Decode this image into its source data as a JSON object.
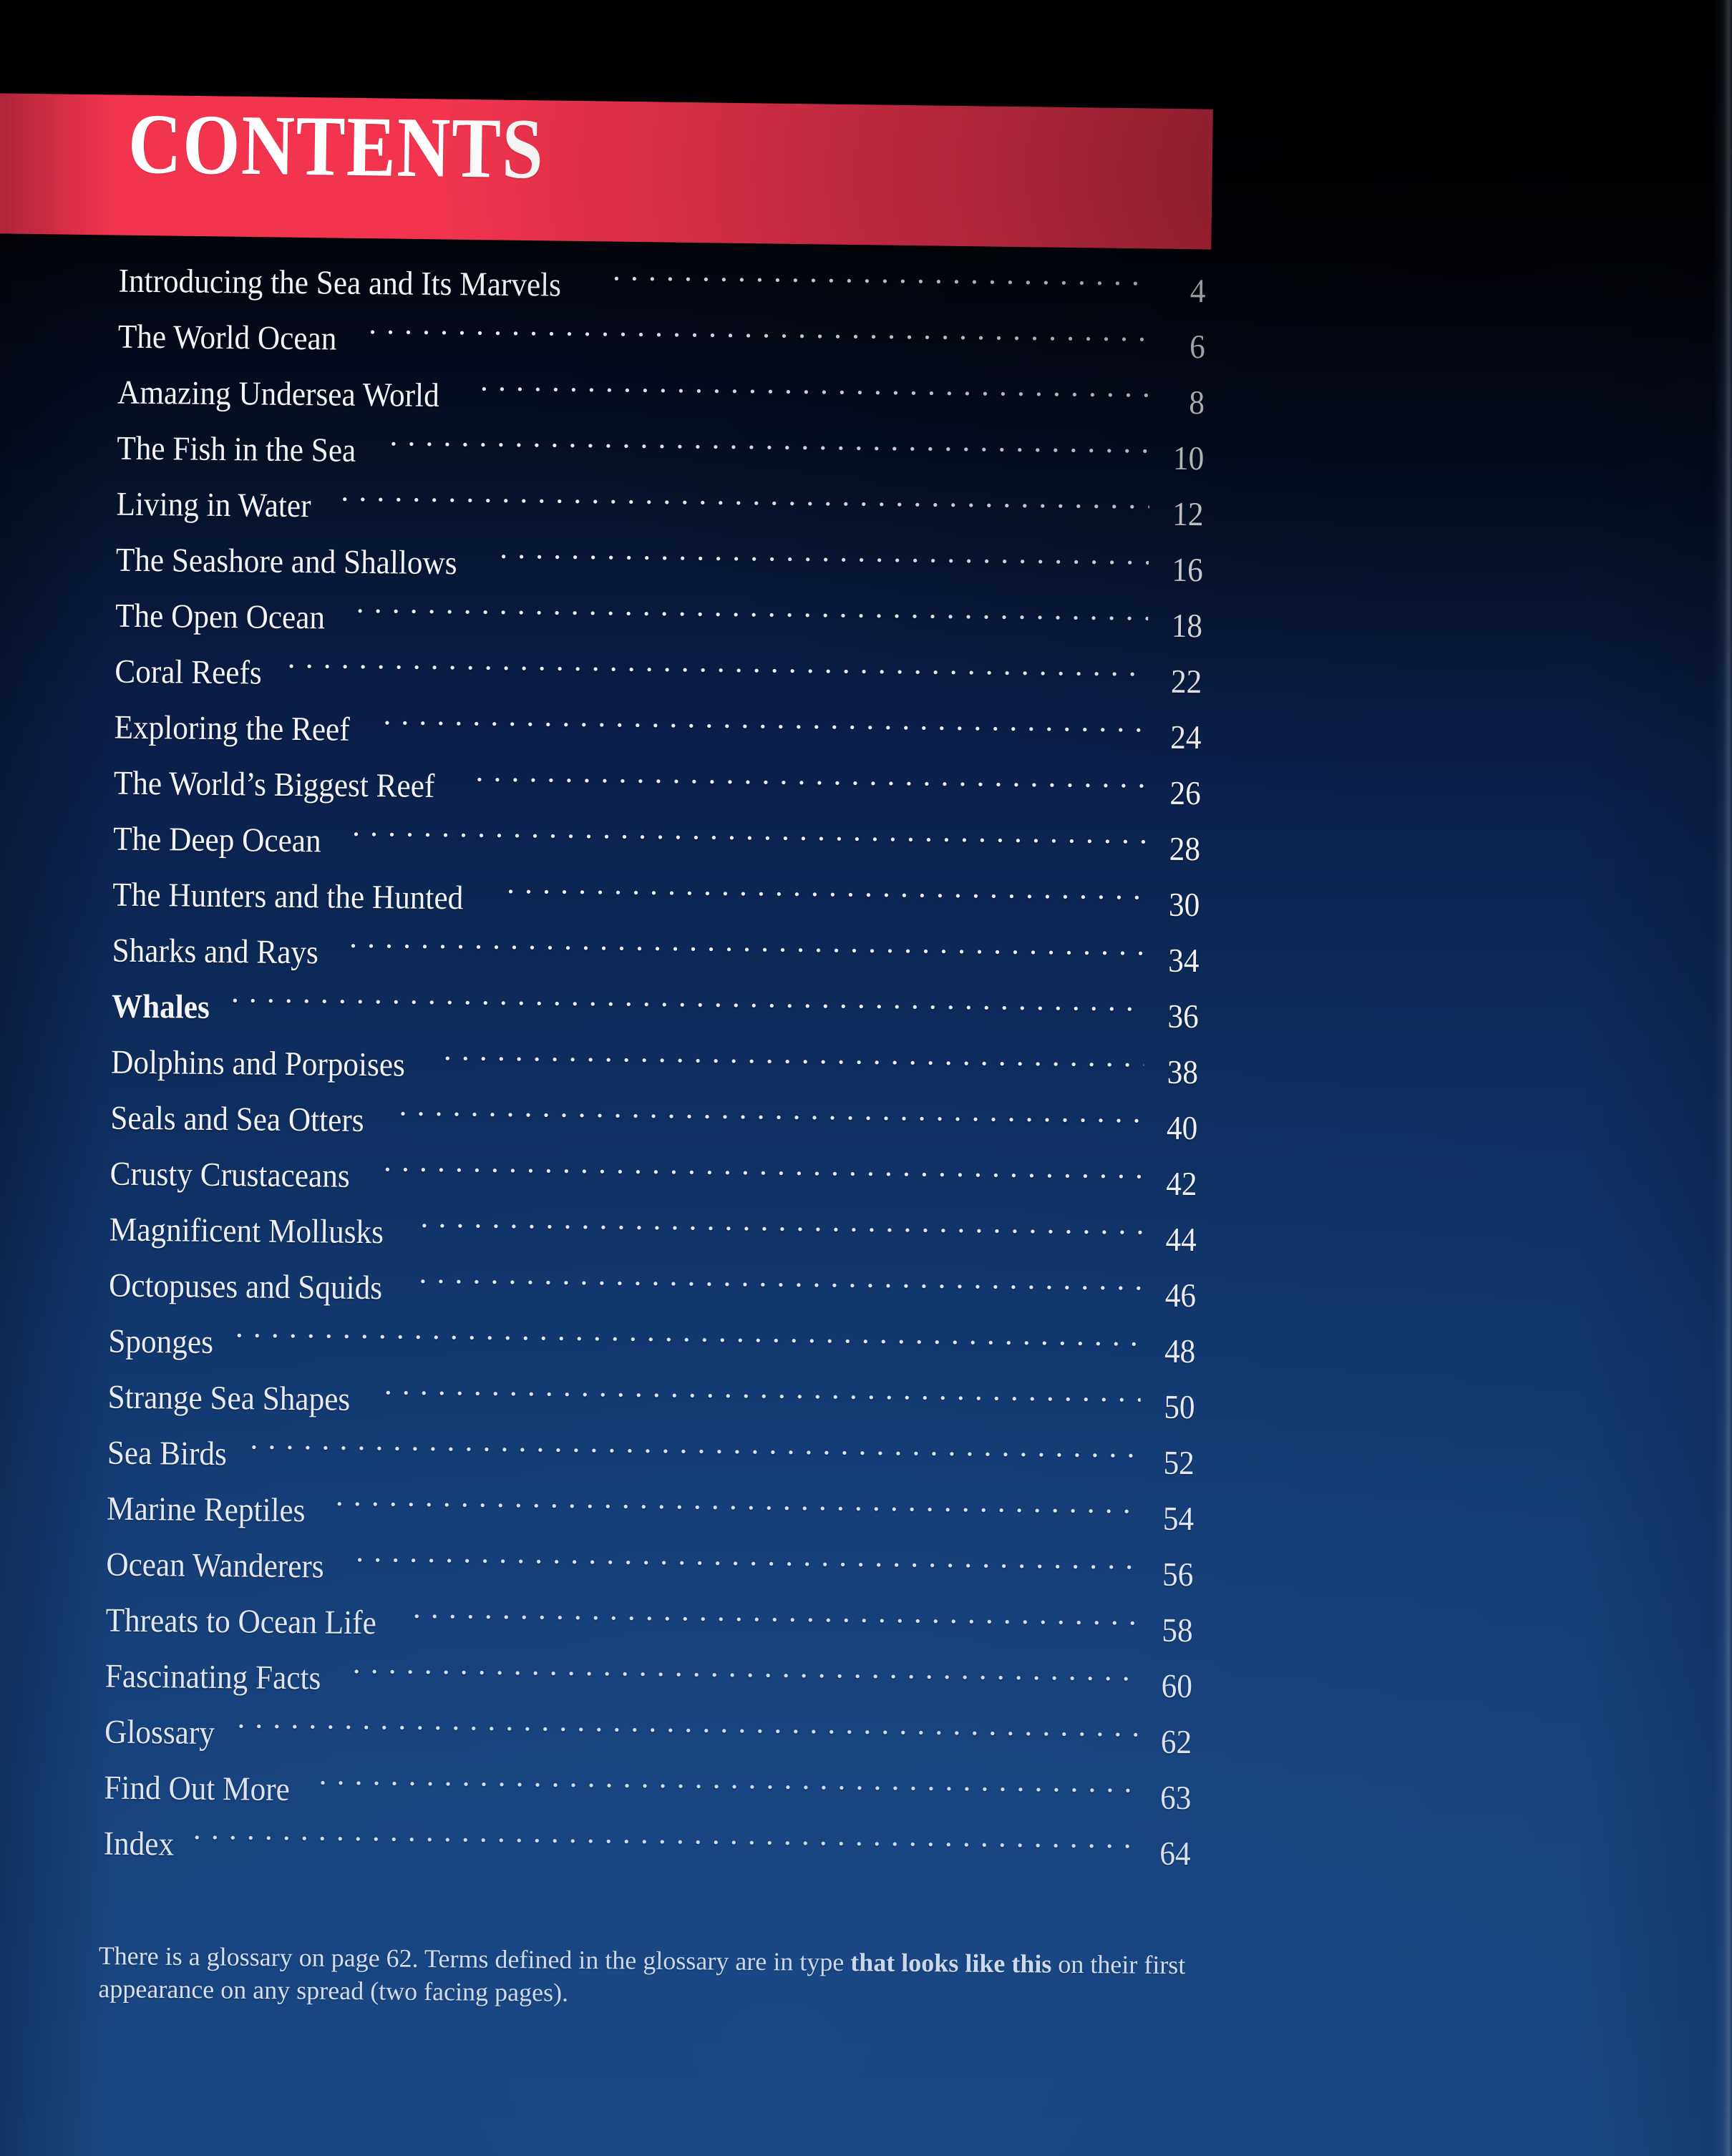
{
  "header": {
    "title": "CONTENTS",
    "banner_color": "#f3344f",
    "title_color": "#ffffff"
  },
  "page": {
    "background_top_color": "#000000",
    "background_bottom_color": "#184480",
    "text_color": "#f2f4f7"
  },
  "contents": {
    "leader_char": ".",
    "entries": [
      {
        "title": "Introducing the Sea and Its Marvels",
        "page": "4"
      },
      {
        "title": "The World Ocean",
        "page": "6"
      },
      {
        "title": "Amazing Undersea World",
        "page": "8"
      },
      {
        "title": "The Fish in the Sea",
        "page": "10"
      },
      {
        "title": "Living in Water",
        "page": "12"
      },
      {
        "title": "The Seashore and Shallows",
        "page": "16"
      },
      {
        "title": "The Open Ocean",
        "page": "18"
      },
      {
        "title": "Coral Reefs",
        "page": "22"
      },
      {
        "title": "Exploring the Reef",
        "page": "24"
      },
      {
        "title": "The World’s Biggest Reef",
        "page": "26"
      },
      {
        "title": "The Deep Ocean",
        "page": "28"
      },
      {
        "title": "The Hunters and the Hunted",
        "page": "30"
      },
      {
        "title": "Sharks and Rays",
        "page": "34"
      },
      {
        "title": "Whales",
        "page": "36"
      },
      {
        "title": "Dolphins and Porpoises",
        "page": "38"
      },
      {
        "title": "Seals and Sea Otters",
        "page": "40"
      },
      {
        "title": "Crusty Crustaceans",
        "page": "42"
      },
      {
        "title": "Magnificent Mollusks",
        "page": "44"
      },
      {
        "title": "Octopuses and Squids",
        "page": "46"
      },
      {
        "title": "Sponges",
        "page": "48"
      },
      {
        "title": "Strange Sea Shapes",
        "page": "50"
      },
      {
        "title": "Sea Birds",
        "page": "52"
      },
      {
        "title": "Marine Reptiles",
        "page": "54"
      },
      {
        "title": "Ocean Wanderers",
        "page": "56"
      },
      {
        "title": "Threats to Ocean Life",
        "page": "58"
      },
      {
        "title": "Fascinating Facts",
        "page": "60"
      },
      {
        "title": "Glossary",
        "page": "62"
      },
      {
        "title": "Find Out More",
        "page": "63"
      },
      {
        "title": "Index",
        "page": "64"
      }
    ]
  },
  "footnote": {
    "part1": "There is a glossary on page 62. Terms defined in the glossary are in type ",
    "emphasis": "that looks like this",
    "part2": " on their first appearance on any spread (two facing pages)."
  }
}
